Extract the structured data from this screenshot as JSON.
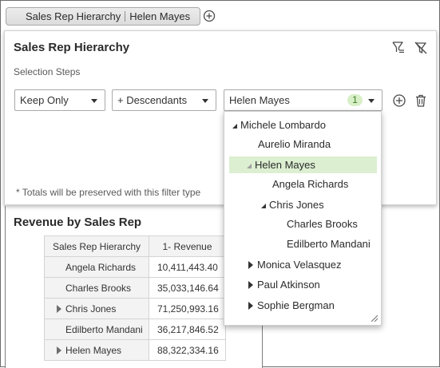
{
  "filter_bar": {
    "pill_dimension": "Sales Rep Hierarchy",
    "pill_value": "Helen Mayes"
  },
  "filter_panel": {
    "title": "Sales Rep Hierarchy",
    "section_label": "Selection Steps",
    "action_dropdown": "Keep Only",
    "relation_dropdown": "+ Descendants",
    "member_dropdown": "Helen Mayes",
    "member_count_badge": "1",
    "totals_note": "* Totals will be preserved with this filter type"
  },
  "hierarchy_popup": {
    "items": [
      {
        "label": "Michele Lombardo",
        "expander": "expanded"
      },
      {
        "label": "Aurelio Miranda",
        "expander": "none"
      },
      {
        "label": "Helen Mayes",
        "expander": "expanded-light",
        "selected": true
      },
      {
        "label": "Angela Richards",
        "expander": "none"
      },
      {
        "label": "Chris Jones",
        "expander": "expanded"
      },
      {
        "label": "Charles Brooks",
        "expander": "none"
      },
      {
        "label": "Edilberto Mandani",
        "expander": "none"
      },
      {
        "label": "Monica Velasquez",
        "expander": "collapsed"
      },
      {
        "label": "Paul Atkinson",
        "expander": "collapsed"
      },
      {
        "label": "Sophie Bergman",
        "expander": "collapsed"
      }
    ]
  },
  "report": {
    "title": "Revenue by Sales Rep",
    "columns": [
      "Sales Rep Hierarchy",
      "1- Revenue"
    ],
    "rows": [
      {
        "name": "Angela Richards",
        "revenue": "10,411,443.40",
        "expandable": false
      },
      {
        "name": "Charles Brooks",
        "revenue": "35,033,146.64",
        "expandable": false
      },
      {
        "name": "Chris Jones",
        "revenue": "71,250,993.16",
        "expandable": true
      },
      {
        "name": "Edilberto Mandani",
        "revenue": "36,217,846.52",
        "expandable": false
      },
      {
        "name": "Helen Mayes",
        "revenue": "88,322,334.16",
        "expandable": true
      }
    ]
  },
  "colors": {
    "selection_highlight": "#dcefd1",
    "badge_background": "#d8efc7",
    "badge_text": "#3b7a22",
    "table_header_bg": "#f3f3f3"
  },
  "icons": {
    "add_filter": "plus-circle-icon",
    "clear_filter": "filter-clear-icon",
    "remove_filter": "filter-remove-icon",
    "add_step": "plus-circle-icon",
    "delete_step": "trash-icon",
    "resize": "resize-grip-icon"
  }
}
